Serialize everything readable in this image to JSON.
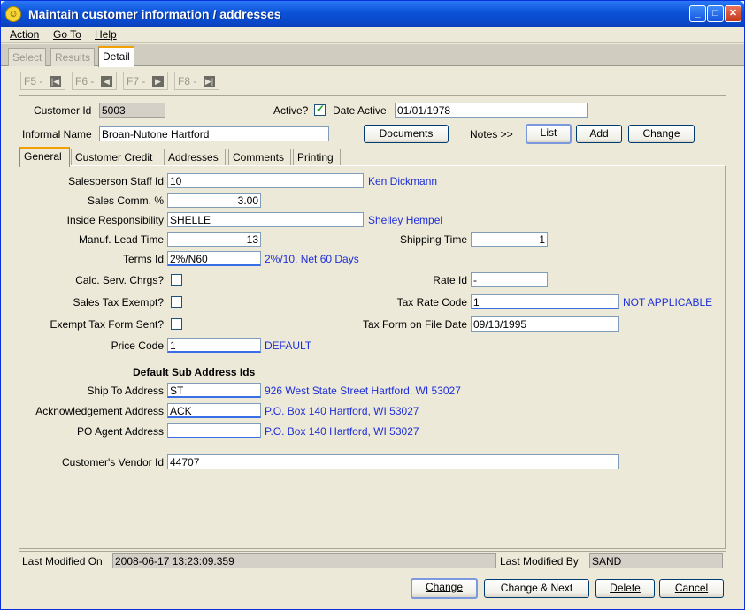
{
  "window": {
    "title": "Maintain customer information / addresses"
  },
  "menu": [
    "Action",
    "Go To",
    "Help"
  ],
  "top_tabs": [
    {
      "label": "Select",
      "active": false
    },
    {
      "label": "Results",
      "active": false
    },
    {
      "label": "Detail",
      "active": true
    }
  ],
  "nav": [
    {
      "label": "F5 -",
      "icon": "first-record-icon"
    },
    {
      "label": "F6 -",
      "icon": "prev-record-icon"
    },
    {
      "label": "F7 -",
      "icon": "next-record-icon"
    },
    {
      "label": "F8 -",
      "icon": "last-record-icon"
    }
  ],
  "header": {
    "customer_id_label": "Customer Id",
    "customer_id": "5003",
    "active_label": "Active?",
    "active": true,
    "date_active_label": "Date Active",
    "date_active": "01/01/1978",
    "informal_name_label": "Informal Name",
    "informal_name": "Broan-Nutone Hartford",
    "documents_btn": "Documents",
    "notes_label": "Notes  >>",
    "list_btn": "List",
    "add_btn": "Add",
    "change_btn": "Change"
  },
  "sub_tabs": [
    "General",
    "Customer Credit",
    "Addresses",
    "Comments",
    "Printing"
  ],
  "general": {
    "salesperson_label": "Salesperson Staff Id",
    "salesperson_id": "10",
    "salesperson_name": "Ken Dickmann",
    "sales_comm_label": "Sales Comm. %",
    "sales_comm": "3.00",
    "inside_resp_label": "Inside Responsibility",
    "inside_resp": "SHELLE",
    "inside_resp_name": "Shelley Hempel",
    "lead_time_label": "Manuf. Lead Time",
    "lead_time": "13",
    "shipping_time_label": "Shipping Time",
    "shipping_time": "1",
    "terms_label": "Terms Id",
    "terms": "2%/N60",
    "terms_desc": "2%/10, Net 60 Days",
    "calc_serv_label": "Calc. Serv. Chrgs?",
    "calc_serv": false,
    "rate_id_label": "Rate Id",
    "rate_id": "-",
    "sales_tax_exempt_label": "Sales Tax Exempt?",
    "sales_tax_exempt": false,
    "tax_rate_code_label": "Tax Rate Code",
    "tax_rate_code": "1",
    "tax_rate_desc": "NOT APPLICABLE",
    "exempt_form_label": "Exempt Tax Form Sent?",
    "exempt_form": false,
    "tax_form_date_label": "Tax Form on File Date",
    "tax_form_date": "09/13/1995",
    "price_code_label": "Price Code",
    "price_code": "1",
    "price_code_desc": "DEFAULT",
    "sub_address_heading": "Default Sub Address Ids",
    "ship_to_label": "Ship To Address",
    "ship_to": "ST",
    "ship_to_desc": "926 West State Street Hartford, WI  53027",
    "ack_label": "Acknowledgement Address",
    "ack": "ACK",
    "ack_desc": "P.O. Box 140 Hartford, WI  53027",
    "po_agent_label": "PO Agent Address",
    "po_agent": "",
    "po_agent_desc": "P.O. Box 140 Hartford, WI  53027",
    "vendor_id_label": "Customer's Vendor Id",
    "vendor_id": "44707"
  },
  "footer": {
    "last_modified_on_label": "Last Modified On",
    "last_modified_on": "2008-06-17 13:23:09.359",
    "last_modified_by_label": "Last Modified By",
    "last_modified_by": "SAND"
  },
  "buttons": {
    "change": "Change",
    "change_next": "Change & Next",
    "delete": "Delete",
    "cancel": "Cancel"
  }
}
